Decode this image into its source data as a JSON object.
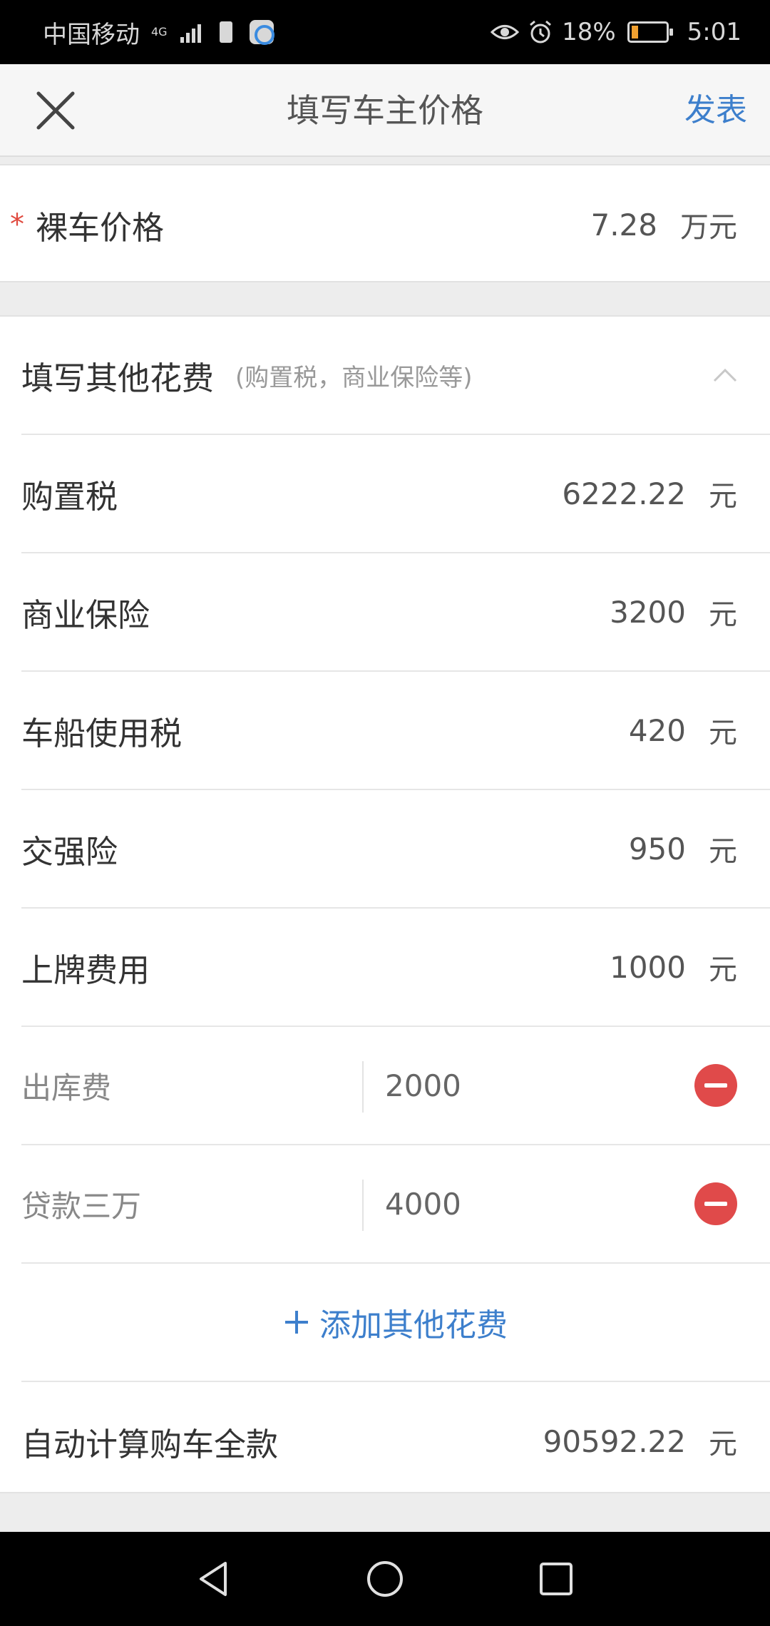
{
  "status_bar": {
    "carrier": "中国移动",
    "network": "4G",
    "battery_percent": "18%",
    "battery_level": 0.18,
    "time": "5:01",
    "icons": [
      "signal-icon",
      "battery-saver-icon",
      "app-notification-icon",
      "eye-icon",
      "alarm-icon",
      "battery-icon"
    ]
  },
  "header": {
    "title": "填写车主价格",
    "publish_label": "发表",
    "close_icon": "close-icon"
  },
  "base_price": {
    "required_mark": "*",
    "label": "裸车价格",
    "value": "7.28",
    "unit": "万元"
  },
  "other_costs": {
    "title": "填写其他花费",
    "hint": "(购置税，商业保险等)",
    "toggle_icon": "chevron-up-icon",
    "items": [
      {
        "label": "购置税",
        "value": "6222.22",
        "unit": "元"
      },
      {
        "label": "商业保险",
        "value": "3200",
        "unit": "元"
      },
      {
        "label": "车船使用税",
        "value": "420",
        "unit": "元"
      },
      {
        "label": "交强险",
        "value": "950",
        "unit": "元"
      },
      {
        "label": "上牌费用",
        "value": "1000",
        "unit": "元"
      }
    ],
    "custom_items": [
      {
        "label": "出库费",
        "value": "2000"
      },
      {
        "label": "贷款三万",
        "value": "4000"
      }
    ],
    "add_label": "添加其他花费"
  },
  "total": {
    "label": "自动计算购车全款",
    "value": "90592.22",
    "unit": "元"
  },
  "colors": {
    "accent": "#3d7fcc",
    "danger": "#e04a4a",
    "required": "#e04a3f"
  }
}
